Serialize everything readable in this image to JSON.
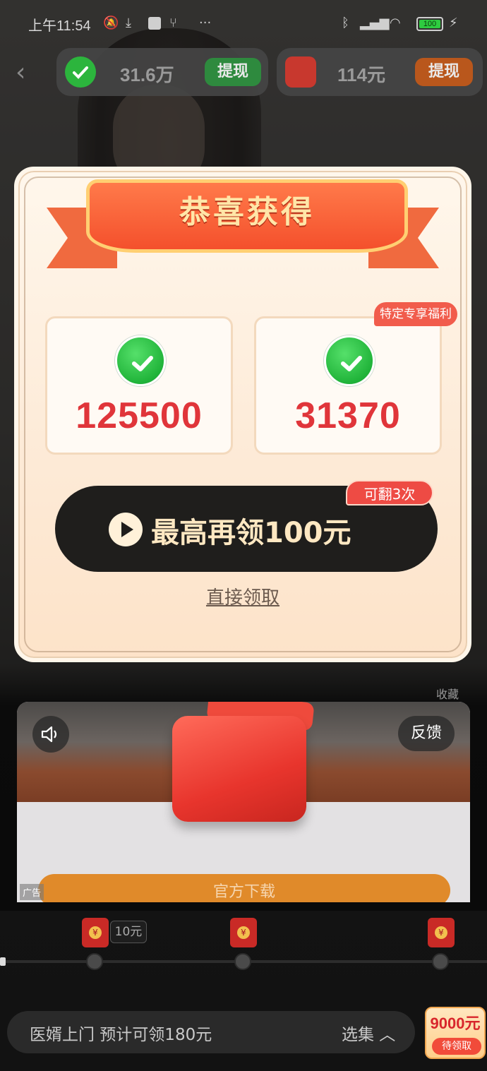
{
  "status_bar": {
    "time": "上午11:54",
    "battery": "100"
  },
  "balances": {
    "coins": "31.6万",
    "coins_withdraw": "提现",
    "cash": "114元",
    "cash_withdraw": "提现"
  },
  "popup": {
    "title": "恭喜获得",
    "cards": [
      {
        "amount": "125500"
      },
      {
        "amount": "31370"
      }
    ],
    "special_tag": "特定专享福利",
    "cta_label": "最高再领100元",
    "cta_tag": "可翻3次",
    "direct_claim": "直接领取"
  },
  "side": {
    "collect": "收藏"
  },
  "ad": {
    "feedback": "反馈",
    "label": "广告",
    "download": "官方下载"
  },
  "reward_track": {
    "chip": "10元"
  },
  "bottom_bar": {
    "title": "医婿上门  预计可领180元",
    "episodes": "选集 ︿",
    "reward_value": "9000元",
    "reward_status": "待领取"
  },
  "colors": {
    "accent_red": "#e0353a",
    "wechat_green": "#21b43a",
    "cta_dark": "#1f1e1c",
    "download_orange": "#e08a2a"
  },
  "icons": [
    "wechat-icon",
    "red-envelope-icon",
    "play-icon",
    "speaker-icon",
    "back-arrow-icon",
    "bell-off-icon",
    "download-icon",
    "bluetooth-icon",
    "wifi-icon",
    "battery-icon"
  ]
}
